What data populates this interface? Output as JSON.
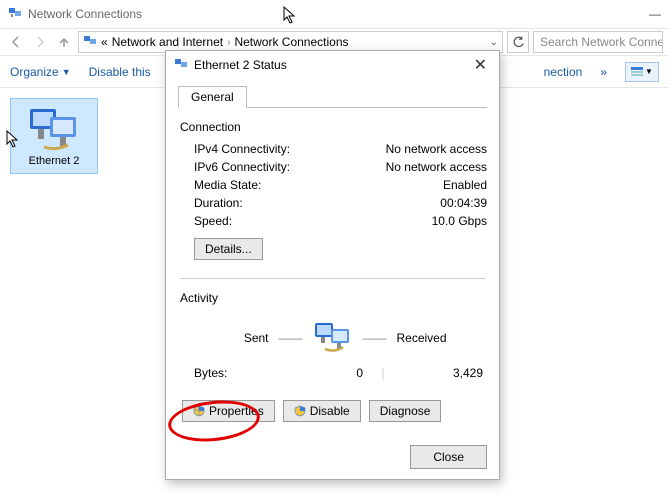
{
  "window": {
    "title": "Network Connections",
    "min_tooltip": "Minimize",
    "breadcrumb": {
      "root_glyph": "«",
      "item1": "Network and Internet",
      "item2": "Network Connections"
    },
    "search_placeholder": "Search Network Connecti",
    "toolbar": {
      "organize": "Organize",
      "disable": "Disable this",
      "connection_fragment": "nection",
      "chevron": "»"
    },
    "adapter": {
      "name": "Ethernet 2"
    }
  },
  "dialog": {
    "title": "Ethernet 2 Status",
    "tab_general": "General",
    "group_connection": "Connection",
    "rows": {
      "ipv4_k": "IPv4 Connectivity:",
      "ipv4_v": "No network access",
      "ipv6_k": "IPv6 Connectivity:",
      "ipv6_v": "No network access",
      "media_k": "Media State:",
      "media_v": "Enabled",
      "duration_k": "Duration:",
      "duration_v": "00:04:39",
      "speed_k": "Speed:",
      "speed_v": "10.0 Gbps"
    },
    "details_btn": "Details...",
    "group_activity": "Activity",
    "sent_label": "Sent",
    "received_label": "Received",
    "bytes_label": "Bytes:",
    "bytes_sent": "0",
    "bytes_recv": "3,429",
    "btn_properties": "Properties",
    "btn_disable": "Disable",
    "btn_diagnose": "Diagnose",
    "btn_close": "Close"
  }
}
